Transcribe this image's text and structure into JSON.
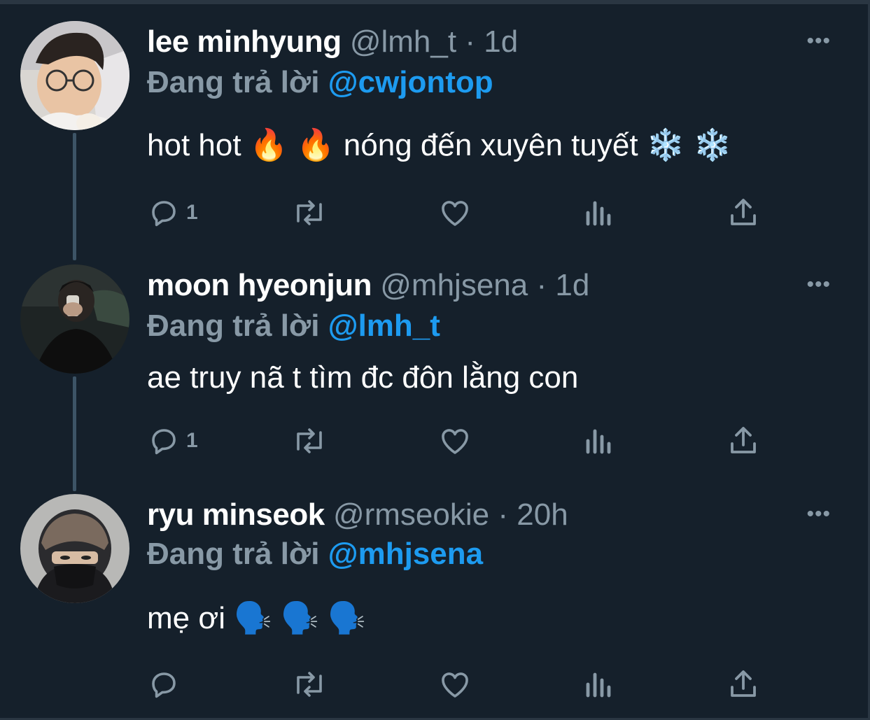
{
  "tweets": [
    {
      "name": "lee minhyung",
      "handle": "@lmh_t",
      "separator": "·",
      "time": "1d",
      "replying_prefix": "Đang trả lời",
      "replying_to": "@cwjontop",
      "text": "hot hot 🔥 🔥 nóng đến xuyên tuyết ❄️ ❄️",
      "reply_count": "1",
      "more_label": "•••"
    },
    {
      "name": "moon hyeonjun",
      "handle": "@mhjsena",
      "separator": "·",
      "time": "1d",
      "replying_prefix": "Đang trả lời",
      "replying_to": "@lmh_t",
      "text": "ae truy nã t tìm đc đôn lằng con",
      "reply_count": "1",
      "more_label": "•••"
    },
    {
      "name": "ryu minseok",
      "handle": "@rmseokie",
      "separator": "·",
      "time": "20h",
      "replying_prefix": "Đang trả lời",
      "replying_to": "@mhjsena",
      "text": "mẹ ơi 🗣️ 🗣️ 🗣️",
      "reply_count": "",
      "more_label": "•••"
    }
  ],
  "colors": {
    "background": "#15202b",
    "name": "#ffffff",
    "secondary": "#8899a6",
    "mention": "#1d9bf0",
    "thread_line": "#3d5466"
  },
  "icons": [
    "reply-icon",
    "retweet-icon",
    "like-icon",
    "analytics-icon",
    "share-icon",
    "more-icon"
  ]
}
